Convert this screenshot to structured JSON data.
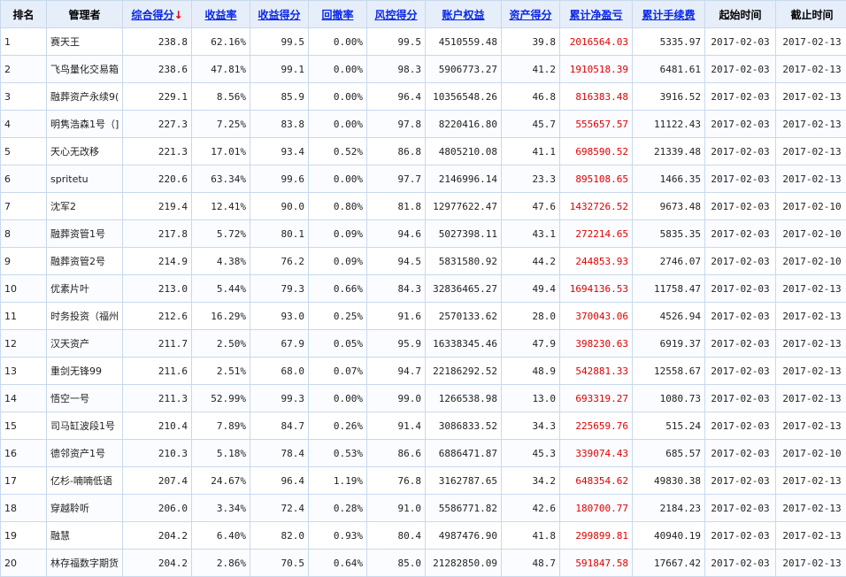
{
  "headers": {
    "rank": "排名",
    "manager": "管理者",
    "score": "综合得分",
    "score_arrow": "↓",
    "return_rate": "收益率",
    "return_score": "收益得分",
    "drawdown": "回撤率",
    "risk_score": "风控得分",
    "equity": "账户权益",
    "asset_score": "资产得分",
    "net_pnl": "累计净盈亏",
    "fees": "累计手续费",
    "start": "起始时间",
    "end": "截止时间"
  },
  "colors": {
    "link": "#0a27e6",
    "loss_profit": "#e00000",
    "header_bg": "#e6eefa",
    "border": "#c8d9ec"
  },
  "rows": [
    {
      "rank": "1",
      "manager": "赛天王",
      "score": "238.8",
      "return_rate": "62.16%",
      "return_score": "99.5",
      "drawdown": "0.00%",
      "risk_score": "99.5",
      "equity": "4510559.48",
      "asset_score": "39.8",
      "net_pnl": "2016564.03",
      "fees": "5335.97",
      "start": "2017-02-03",
      "end": "2017-02-13"
    },
    {
      "rank": "2",
      "manager": "飞鸟量化交易箱",
      "score": "238.6",
      "return_rate": "47.81%",
      "return_score": "99.1",
      "drawdown": "0.00%",
      "risk_score": "98.3",
      "equity": "5906773.27",
      "asset_score": "41.2",
      "net_pnl": "1910518.39",
      "fees": "6481.61",
      "start": "2017-02-03",
      "end": "2017-02-13"
    },
    {
      "rank": "3",
      "manager": "融葬资产永续9(",
      "score": "229.1",
      "return_rate": "8.56%",
      "return_score": "85.9",
      "drawdown": "0.00%",
      "risk_score": "96.4",
      "equity": "10356548.26",
      "asset_score": "46.8",
      "net_pnl": "816383.48",
      "fees": "3916.52",
      "start": "2017-02-03",
      "end": "2017-02-13"
    },
    {
      "rank": "4",
      "manager": "明隽浩森1号（]",
      "score": "227.3",
      "return_rate": "7.25%",
      "return_score": "83.8",
      "drawdown": "0.00%",
      "risk_score": "97.8",
      "equity": "8220416.80",
      "asset_score": "45.7",
      "net_pnl": "555657.57",
      "fees": "11122.43",
      "start": "2017-02-03",
      "end": "2017-02-13"
    },
    {
      "rank": "5",
      "manager": "天心无改移",
      "score": "221.3",
      "return_rate": "17.01%",
      "return_score": "93.4",
      "drawdown": "0.52%",
      "risk_score": "86.8",
      "equity": "4805210.08",
      "asset_score": "41.1",
      "net_pnl": "698590.52",
      "fees": "21339.48",
      "start": "2017-02-03",
      "end": "2017-02-13"
    },
    {
      "rank": "6",
      "manager": "spritetu",
      "score": "220.6",
      "return_rate": "63.34%",
      "return_score": "99.6",
      "drawdown": "0.00%",
      "risk_score": "97.7",
      "equity": "2146996.14",
      "asset_score": "23.3",
      "net_pnl": "895108.65",
      "fees": "1466.35",
      "start": "2017-02-03",
      "end": "2017-02-13"
    },
    {
      "rank": "7",
      "manager": "沈军2",
      "score": "219.4",
      "return_rate": "12.41%",
      "return_score": "90.0",
      "drawdown": "0.80%",
      "risk_score": "81.8",
      "equity": "12977622.47",
      "asset_score": "47.6",
      "net_pnl": "1432726.52",
      "fees": "9673.48",
      "start": "2017-02-03",
      "end": "2017-02-10"
    },
    {
      "rank": "8",
      "manager": "融葬资管1号",
      "score": "217.8",
      "return_rate": "5.72%",
      "return_score": "80.1",
      "drawdown": "0.09%",
      "risk_score": "94.6",
      "equity": "5027398.11",
      "asset_score": "43.1",
      "net_pnl": "272214.65",
      "fees": "5835.35",
      "start": "2017-02-03",
      "end": "2017-02-10"
    },
    {
      "rank": "9",
      "manager": "融葬资管2号",
      "score": "214.9",
      "return_rate": "4.38%",
      "return_score": "76.2",
      "drawdown": "0.09%",
      "risk_score": "94.5",
      "equity": "5831580.92",
      "asset_score": "44.2",
      "net_pnl": "244853.93",
      "fees": "2746.07",
      "start": "2017-02-03",
      "end": "2017-02-10"
    },
    {
      "rank": "10",
      "manager": "优素片叶",
      "score": "213.0",
      "return_rate": "5.44%",
      "return_score": "79.3",
      "drawdown": "0.66%",
      "risk_score": "84.3",
      "equity": "32836465.27",
      "asset_score": "49.4",
      "net_pnl": "1694136.53",
      "fees": "11758.47",
      "start": "2017-02-03",
      "end": "2017-02-13"
    },
    {
      "rank": "11",
      "manager": "时务投资（福州",
      "score": "212.6",
      "return_rate": "16.29%",
      "return_score": "93.0",
      "drawdown": "0.25%",
      "risk_score": "91.6",
      "equity": "2570133.62",
      "asset_score": "28.0",
      "net_pnl": "370043.06",
      "fees": "4526.94",
      "start": "2017-02-03",
      "end": "2017-02-13"
    },
    {
      "rank": "12",
      "manager": "汉天资产",
      "score": "211.7",
      "return_rate": "2.50%",
      "return_score": "67.9",
      "drawdown": "0.05%",
      "risk_score": "95.9",
      "equity": "16338345.46",
      "asset_score": "47.9",
      "net_pnl": "398230.63",
      "fees": "6919.37",
      "start": "2017-02-03",
      "end": "2017-02-13"
    },
    {
      "rank": "13",
      "manager": "重剑无锋99",
      "score": "211.6",
      "return_rate": "2.51%",
      "return_score": "68.0",
      "drawdown": "0.07%",
      "risk_score": "94.7",
      "equity": "22186292.52",
      "asset_score": "48.9",
      "net_pnl": "542881.33",
      "fees": "12558.67",
      "start": "2017-02-03",
      "end": "2017-02-13"
    },
    {
      "rank": "14",
      "manager": "悟空一号",
      "score": "211.3",
      "return_rate": "52.99%",
      "return_score": "99.3",
      "drawdown": "0.00%",
      "risk_score": "99.0",
      "equity": "1266538.98",
      "asset_score": "13.0",
      "net_pnl": "693319.27",
      "fees": "1080.73",
      "start": "2017-02-03",
      "end": "2017-02-13"
    },
    {
      "rank": "15",
      "manager": "司马缸波段1号",
      "score": "210.4",
      "return_rate": "7.89%",
      "return_score": "84.7",
      "drawdown": "0.26%",
      "risk_score": "91.4",
      "equity": "3086833.52",
      "asset_score": "34.3",
      "net_pnl": "225659.76",
      "fees": "515.24",
      "start": "2017-02-03",
      "end": "2017-02-13"
    },
    {
      "rank": "16",
      "manager": "德邻资产1号",
      "score": "210.3",
      "return_rate": "5.18%",
      "return_score": "78.4",
      "drawdown": "0.53%",
      "risk_score": "86.6",
      "equity": "6886471.87",
      "asset_score": "45.3",
      "net_pnl": "339074.43",
      "fees": "685.57",
      "start": "2017-02-03",
      "end": "2017-02-10"
    },
    {
      "rank": "17",
      "manager": "亿杉-喃喃低语",
      "score": "207.4",
      "return_rate": "24.67%",
      "return_score": "96.4",
      "drawdown": "1.19%",
      "risk_score": "76.8",
      "equity": "3162787.65",
      "asset_score": "34.2",
      "net_pnl": "648354.62",
      "fees": "49830.38",
      "start": "2017-02-03",
      "end": "2017-02-13"
    },
    {
      "rank": "18",
      "manager": "穿越聆听",
      "score": "206.0",
      "return_rate": "3.34%",
      "return_score": "72.4",
      "drawdown": "0.28%",
      "risk_score": "91.0",
      "equity": "5586771.82",
      "asset_score": "42.6",
      "net_pnl": "180700.77",
      "fees": "2184.23",
      "start": "2017-02-03",
      "end": "2017-02-13"
    },
    {
      "rank": "19",
      "manager": "融慧",
      "score": "204.2",
      "return_rate": "6.40%",
      "return_score": "82.0",
      "drawdown": "0.93%",
      "risk_score": "80.4",
      "equity": "4987476.90",
      "asset_score": "41.8",
      "net_pnl": "299899.81",
      "fees": "40940.19",
      "start": "2017-02-03",
      "end": "2017-02-13"
    },
    {
      "rank": "20",
      "manager": "林存福数字期货",
      "score": "204.2",
      "return_rate": "2.86%",
      "return_score": "70.5",
      "drawdown": "0.64%",
      "risk_score": "85.0",
      "equity": "21282850.09",
      "asset_score": "48.7",
      "net_pnl": "591847.58",
      "fees": "17667.42",
      "start": "2017-02-03",
      "end": "2017-02-13"
    }
  ]
}
